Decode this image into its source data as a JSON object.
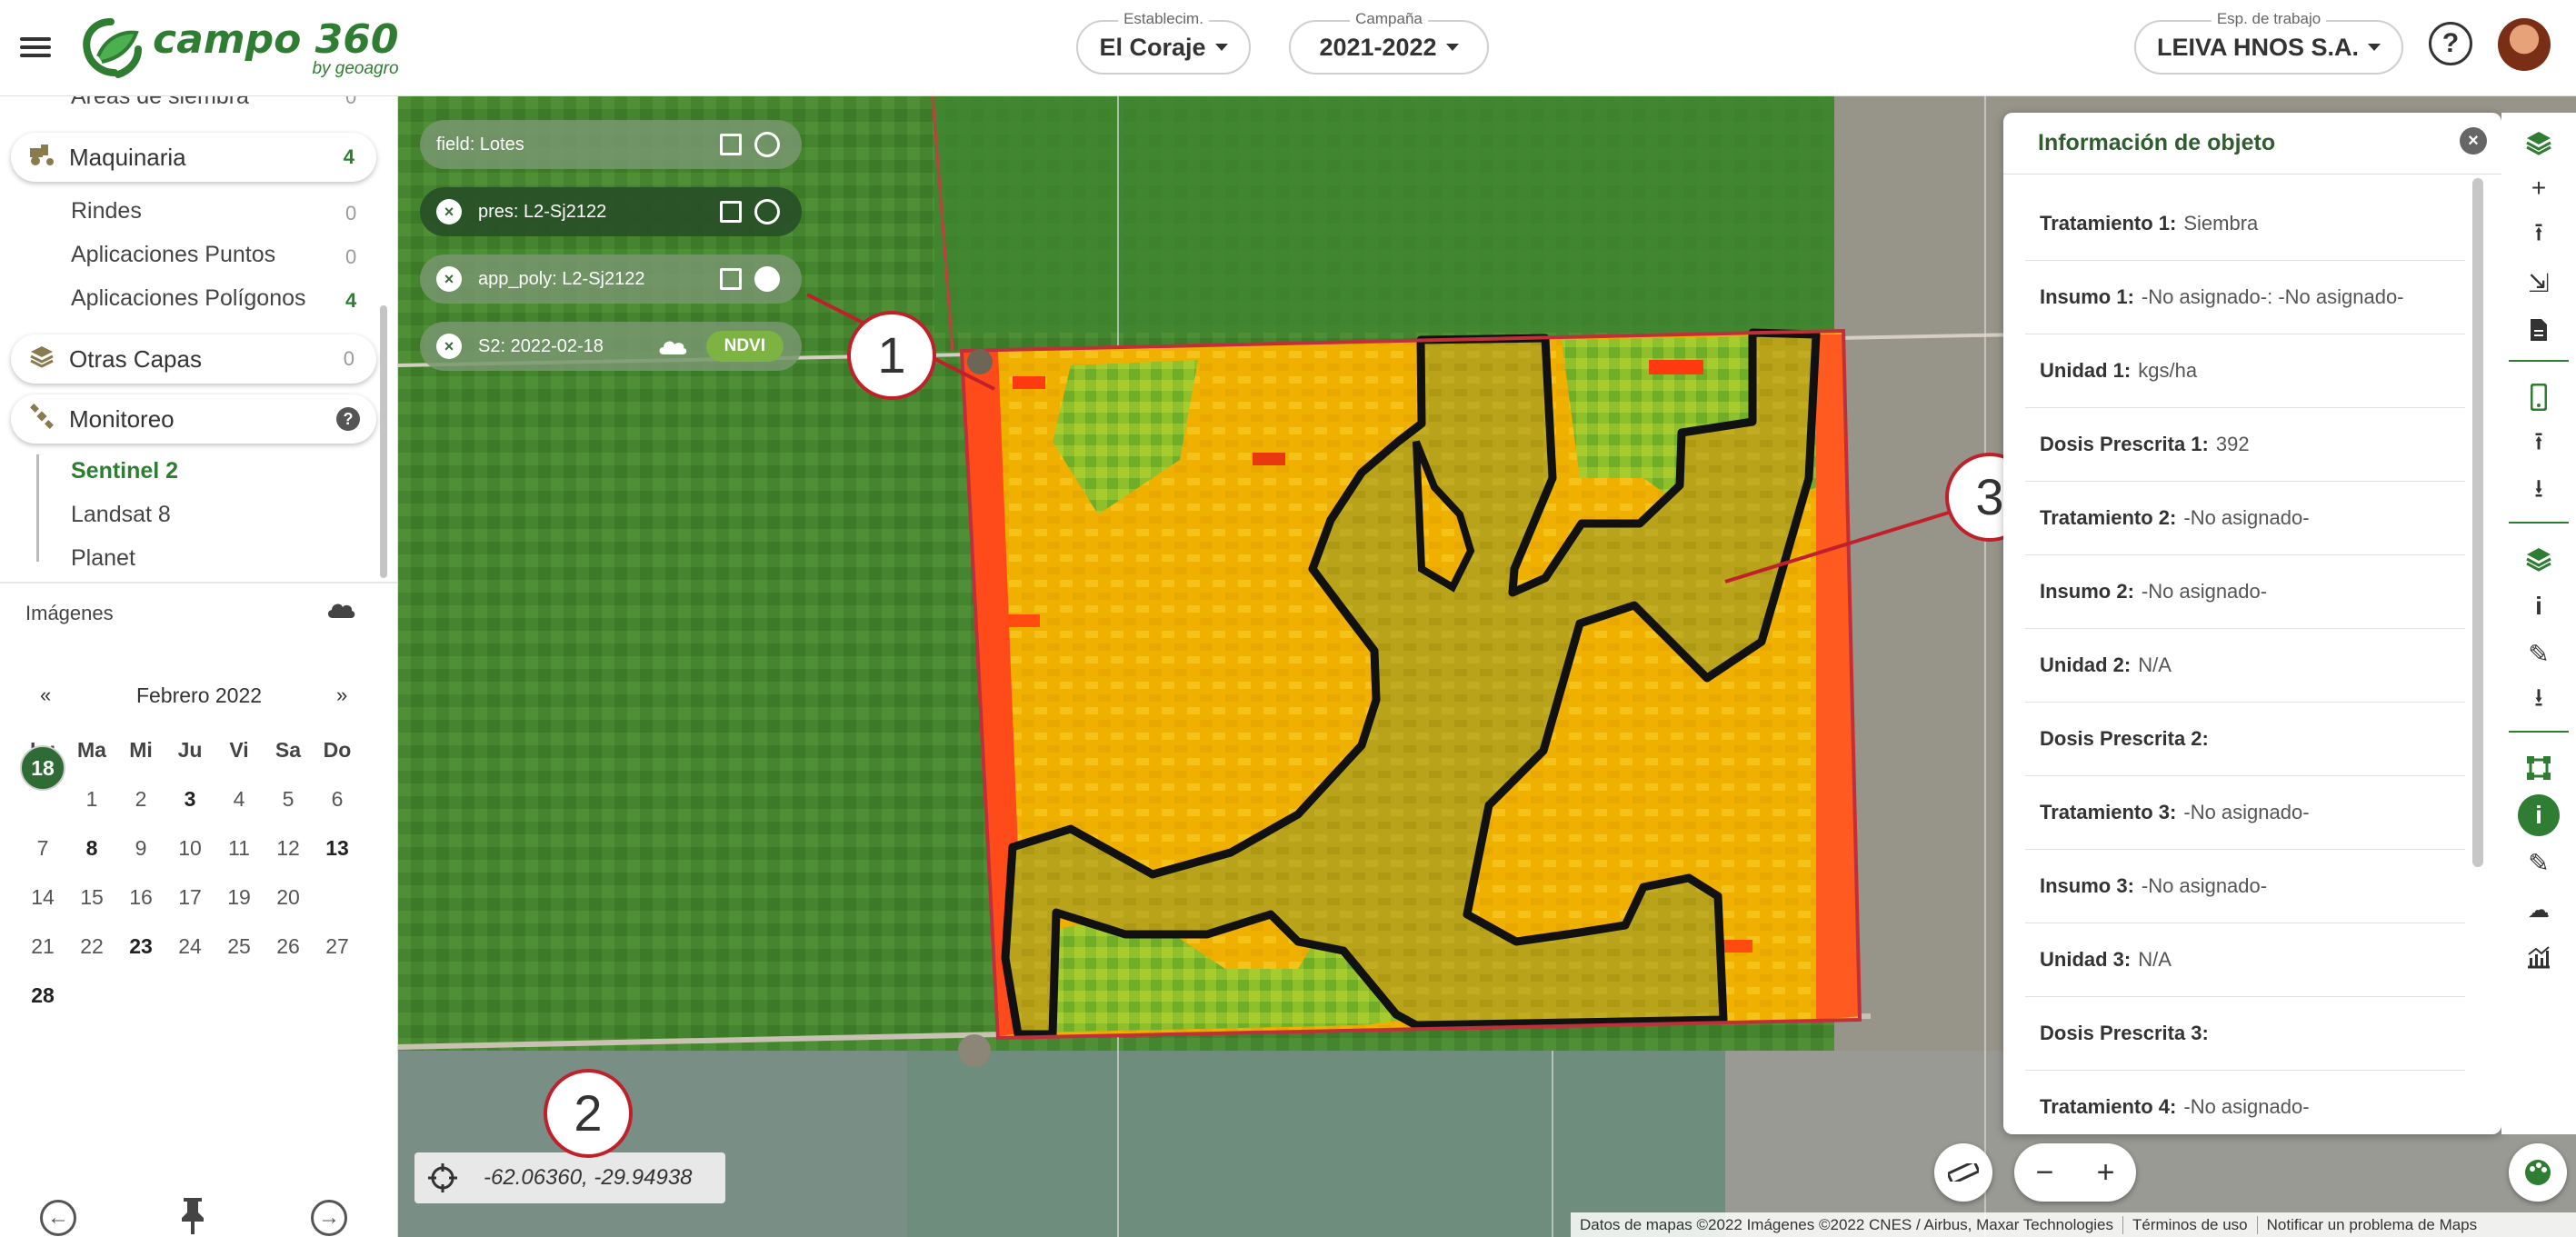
{
  "header": {
    "logo_main": "campo 360",
    "logo_sub": "by geoagro",
    "establecimiento": {
      "label": "Establecim.",
      "value": "El Coraje"
    },
    "campana": {
      "label": "Campaña",
      "value": "2021-2022"
    },
    "espacio": {
      "label": "Esp. de trabajo",
      "value": "LEIVA HNOS S.A."
    },
    "help": "?"
  },
  "sidebar": {
    "areas": {
      "label": "Áreas de siembra",
      "count": "0"
    },
    "maquinaria": {
      "label": "Maquinaria",
      "count": "4"
    },
    "maquinaria_items": [
      {
        "label": "Rindes",
        "count": "0"
      },
      {
        "label": "Aplicaciones Puntos",
        "count": "0"
      },
      {
        "label": "Aplicaciones Polígonos",
        "count": "4"
      }
    ],
    "otras": {
      "label": "Otras Capas",
      "count": "0"
    },
    "monitoreo": {
      "label": "Monitoreo",
      "help": "?"
    },
    "monitoreo_items": [
      {
        "label": "Sentinel 2"
      },
      {
        "label": "Landsat 8"
      },
      {
        "label": "Planet"
      }
    ],
    "imagenes_label": "Imágenes"
  },
  "calendar": {
    "prev": "«",
    "next": "»",
    "month": "Febrero 2022",
    "weekdays": [
      "Lu",
      "Ma",
      "Mi",
      "Ju",
      "Vi",
      "Sa",
      "Do"
    ],
    "weeks": [
      [
        "",
        "1",
        "2",
        "3",
        "4",
        "5",
        "6"
      ],
      [
        "7",
        "8",
        "9",
        "10",
        "11",
        "12",
        "13"
      ],
      [
        "14",
        "15",
        "16",
        "17",
        "18",
        "19",
        "20"
      ],
      [
        "21",
        "22",
        "23",
        "24",
        "25",
        "26",
        "27"
      ],
      [
        "28",
        "",
        "",
        "",
        "",
        "",
        ""
      ]
    ],
    "bold_days": [
      "3",
      "8",
      "13",
      "23",
      "28"
    ],
    "selected_day": "18",
    "footer_dash": "-"
  },
  "layers": [
    {
      "label": "field: Lotes",
      "closable": false,
      "palette_filled": false
    },
    {
      "label": "pres: L2-Sj2122",
      "closable": true,
      "palette_filled": false
    },
    {
      "label": "app_poly: L2-Sj2122",
      "closable": true,
      "palette_filled": true
    },
    {
      "label": "S2: 2022-02-18",
      "closable": true,
      "badge": "NDVI"
    }
  ],
  "callouts": [
    "1",
    "2",
    "3"
  ],
  "coordinates": "-62.06360, -29.94938",
  "attribution": [
    "Datos de mapas ©2022 Imágenes ©2022 CNES / Airbus, Maxar Technologies",
    "Términos de uso",
    "Notificar un problema de Maps"
  ],
  "info_panel": {
    "title": "Información de objeto",
    "close": "×",
    "rows": [
      {
        "key": "Tratamiento 1:",
        "value": "Siembra"
      },
      {
        "key": "Insumo 1:",
        "value": "-No asignado-: -No asignado-"
      },
      {
        "key": "Unidad 1:",
        "value": "kgs/ha"
      },
      {
        "key": "Dosis Prescrita 1:",
        "value": "392"
      },
      {
        "key": "Tratamiento 2:",
        "value": "-No asignado-"
      },
      {
        "key": "Insumo 2:",
        "value": "-No asignado-"
      },
      {
        "key": "Unidad 2:",
        "value": "N/A"
      },
      {
        "key": "Dosis Prescrita 2:",
        "value": ""
      },
      {
        "key": "Tratamiento 3:",
        "value": "-No asignado-"
      },
      {
        "key": "Insumo 3:",
        "value": "-No asignado-"
      },
      {
        "key": "Unidad 3:",
        "value": "N/A"
      },
      {
        "key": "Dosis Prescrita 3:",
        "value": ""
      },
      {
        "key": "Tratamiento 4:",
        "value": "-No asignado-"
      }
    ]
  },
  "toolbar_icons": [
    "layers-icon",
    "add-icon",
    "upload-icon",
    "import-file-icon",
    "file-icon",
    "mobile-icon",
    "upload-icon",
    "download-icon",
    "layers-icon",
    "info-icon",
    "edit-icon",
    "download-icon",
    "polygon-icon",
    "info-icon",
    "pencil-icon",
    "weather-icon",
    "chart-icon"
  ],
  "map_controls": {
    "zoom_out": "−",
    "zoom_in": "+"
  },
  "colors": {
    "brand_green": "#2e7d32",
    "callout_red": "#c0202a"
  }
}
